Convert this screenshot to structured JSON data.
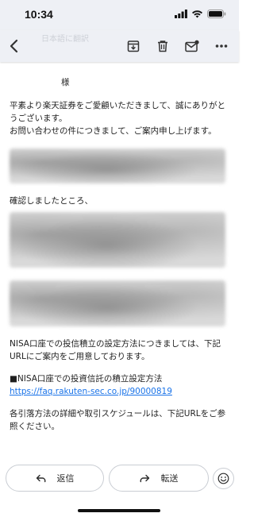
{
  "status_bar": {
    "time": "10:34"
  },
  "toolbar": {
    "ghost_title": "日本語に翻訳",
    "icons": [
      "back-icon",
      "archive-icon",
      "trash-icon",
      "mark-unread-icon",
      "more-icon"
    ]
  },
  "email": {
    "salutation": "様",
    "intro": "平素より楽天証券をご愛顧いただきまして、誠にありがとうございます。",
    "intro2": "お問い合わせの件につきまして、ご案内申し上げます。",
    "confirm": "確認しましたところ、",
    "nisa_para": "NISA口座での投信積立の設定方法につきましては、下記URLにご案内をご用意しております。",
    "nisa_heading": "■NISA口座での投資信託の積立設定方法",
    "nisa_link": "https://faq.rakuten-sec.co.jp/90000819",
    "schedule_para": "各引落方法の詳細や取引スケジュールは、下記URLをご参照ください。"
  },
  "actions": {
    "reply_label": "返信",
    "forward_label": "転送"
  }
}
